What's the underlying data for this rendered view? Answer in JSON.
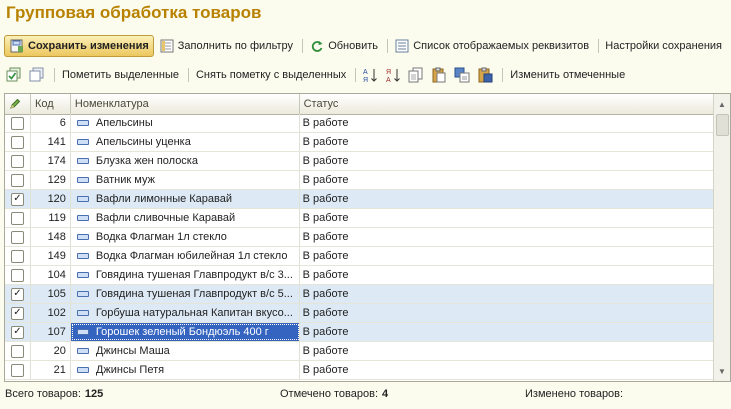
{
  "title": "Групповая обработка товаров",
  "toolbar1": {
    "save": "Сохранить изменения",
    "fill": "Заполнить по фильтру",
    "refresh": "Обновить",
    "list": "Список отображаемых реквизитов",
    "settings": "Настройки сохранения"
  },
  "toolbar2": {
    "mark": "Пометить выделенные",
    "unmark": "Снять пометку с выделенных",
    "change": "Изменить отмеченные"
  },
  "columns": {
    "check": "✎",
    "code": "Код",
    "name": "Номенклатура",
    "status": "Статус"
  },
  "rows": [
    {
      "checked": false,
      "code": "6",
      "name": "Апельсины",
      "status": "В работе"
    },
    {
      "checked": false,
      "code": "141",
      "name": "Апельсины уценка",
      "status": "В работе"
    },
    {
      "checked": false,
      "code": "174",
      "name": "Блузка жен полоска",
      "status": "В работе"
    },
    {
      "checked": false,
      "code": "129",
      "name": "Ватник муж",
      "status": "В работе"
    },
    {
      "checked": true,
      "code": "120",
      "name": "Вафли лимонные Каравай",
      "status": "В работе"
    },
    {
      "checked": false,
      "code": "119",
      "name": "Вафли сливочные Каравай",
      "status": "В работе"
    },
    {
      "checked": false,
      "code": "148",
      "name": "Водка Флагман 1л стекло",
      "status": "В работе"
    },
    {
      "checked": false,
      "code": "149",
      "name": "Водка Флагман юбилейная 1л стекло",
      "status": "В работе"
    },
    {
      "checked": false,
      "code": "104",
      "name": "Говядина тушеная Главпродукт в/с 3...",
      "status": "В работе"
    },
    {
      "checked": true,
      "code": "105",
      "name": "Говядина тушеная Главпродукт в/с 5...",
      "status": "В работе"
    },
    {
      "checked": true,
      "code": "102",
      "name": "Горбуша натуральная Капитан вкусо...",
      "status": "В работе"
    },
    {
      "checked": true,
      "code": "107",
      "name": "Горошек зеленый Бондюэль 400 г",
      "status": "В работе"
    },
    {
      "checked": false,
      "code": "20",
      "name": "Джинсы Маша",
      "status": "В работе"
    },
    {
      "checked": false,
      "code": "21",
      "name": "Джинсы Петя",
      "status": "В работе"
    }
  ],
  "status_bar": {
    "total_label": "Всего товаров:",
    "total": "125",
    "marked_label": "Отмечено товаров:",
    "marked": "4",
    "changed_label": "Изменено товаров:",
    "changed": ""
  },
  "colors": {
    "title": "#b88200",
    "selected_row": "#ddeaf6",
    "focus_cell": "#3564c0",
    "background": "#fbfcee"
  }
}
